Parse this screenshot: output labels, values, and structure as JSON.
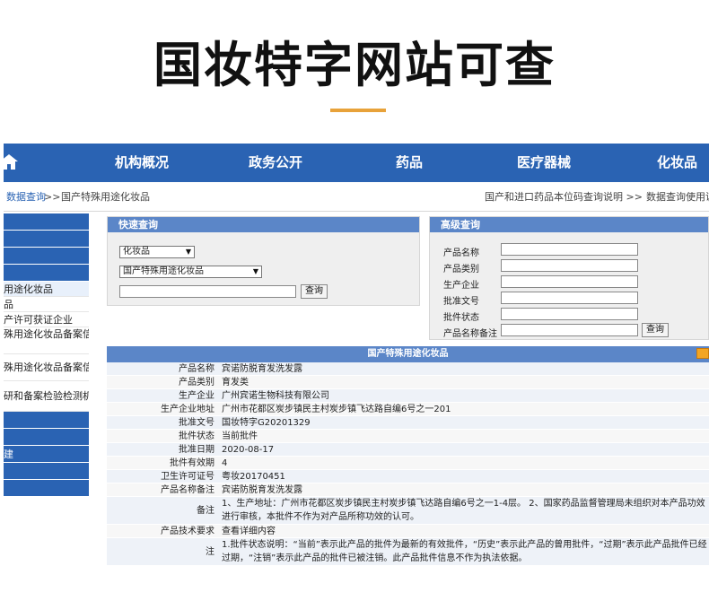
{
  "hero": {
    "title": "国妆特字网站可查",
    "underline_color": "#e8a23a"
  },
  "nav": {
    "bg_color": "#2a63b3",
    "home_icon": "home-icon",
    "items": [
      "机构概况",
      "政务公开",
      "药品",
      "医疗器械",
      "化妆品"
    ]
  },
  "breadcrumb": {
    "link": "数据查询",
    "sep": ">>",
    "current": "国产特殊用途化妆品",
    "right1": "国产和进口药品本位码查询说明 >>",
    "right2": "数据查询使用说明"
  },
  "sidebar": {
    "items": [
      "",
      "",
      "",
      "",
      "用途化妆品",
      "品",
      "产许可获证企业",
      "殊用途化妆品备案信",
      "殊用途化妆品备案信",
      "研和备案检验检测机",
      "",
      "",
      "建",
      "",
      ""
    ]
  },
  "quick": {
    "title": "快速查询",
    "category_value": "化妆品",
    "type_value": "国产特殊用途化妆品",
    "search_value": "",
    "button": "查询"
  },
  "advanced": {
    "title": "高级查询",
    "fields": [
      "产品名称",
      "产品类别",
      "生产企业",
      "批准文号",
      "批件状态",
      "产品名称备注"
    ],
    "button": "查询"
  },
  "result": {
    "title": "国产特殊用途化妆品",
    "rows": [
      {
        "label": "产品名称",
        "value": "宾诺防脱育发洗发露"
      },
      {
        "label": "产品类别",
        "value": "育发类"
      },
      {
        "label": "生产企业",
        "value": "广州宾诺生物科技有限公司"
      },
      {
        "label": "生产企业地址",
        "value": "广州市花都区炭步镇民主村炭步镇飞达路自编6号之一201"
      },
      {
        "label": "批准文号",
        "value": "国妆特字G20201329"
      },
      {
        "label": "批件状态",
        "value": "当前批件"
      },
      {
        "label": "批准日期",
        "value": "2020-08-17"
      },
      {
        "label": "批件有效期",
        "value": "4"
      },
      {
        "label": "卫生许可证号",
        "value": "粤妆20170451"
      },
      {
        "label": "产品名称备注",
        "value": "宾诺防脱育发洗发露"
      },
      {
        "label": "备注",
        "value": "1、生产地址：广州市花都区炭步镇民主村炭步镇飞达路自编6号之一1-4层。 2、国家药品监督管理局未组织对本产品功效进行审核，本批件不作为对产品所称功效的认可。"
      },
      {
        "label": "产品技术要求",
        "value": "查看详细内容"
      },
      {
        "label": "注",
        "value": "1.批件状态说明：“当前”表示此产品的批件为最新的有效批件，“历史”表示此产品的曾用批件，“过期”表示此产品批件已经过期，“注销”表示此产品的批件已被注销。此产品批件信息不作为执法依据。"
      }
    ]
  }
}
